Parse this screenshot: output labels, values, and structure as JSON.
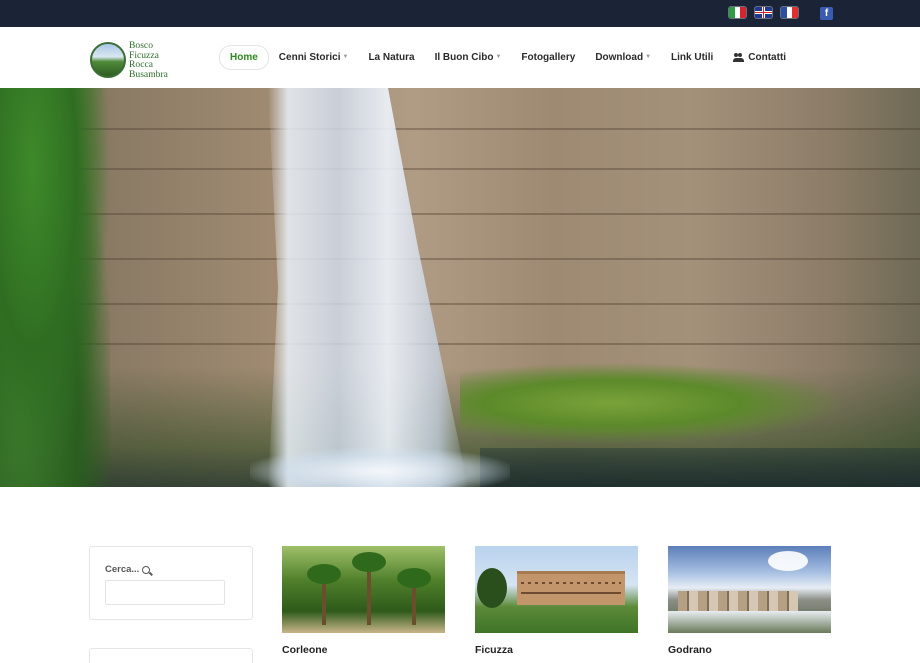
{
  "topbar": {
    "flags": [
      {
        "name": "italian-flag-icon",
        "colors": [
          "#2e9b46",
          "#ffffff",
          "#d4262e"
        ]
      },
      {
        "name": "uk-flag-icon",
        "colors": [
          "#1f3a8c",
          "#ffffff",
          "#d22222"
        ]
      },
      {
        "name": "french-flag-icon",
        "colors": [
          "#2a4ea1",
          "#ffffff",
          "#e0312f"
        ]
      }
    ],
    "facebook": "f",
    "background": "#1b2436"
  },
  "logo": {
    "lines": [
      "Bosco",
      "Ficuzza",
      "Rocca",
      "Busambra"
    ]
  },
  "nav": {
    "items": [
      {
        "label": "Home",
        "active": true,
        "dropdown": false
      },
      {
        "label": "Cenni Storici",
        "active": false,
        "dropdown": true
      },
      {
        "label": "La Natura",
        "active": false,
        "dropdown": false
      },
      {
        "label": "Il Buon Cibo",
        "active": false,
        "dropdown": true
      },
      {
        "label": "Fotogallery",
        "active": false,
        "dropdown": false
      },
      {
        "label": "Download",
        "active": false,
        "dropdown": true
      },
      {
        "label": "Link Utili",
        "active": false,
        "dropdown": false
      },
      {
        "label": "Contatti",
        "active": false,
        "dropdown": false,
        "icon": "users-icon"
      }
    ],
    "active_color": "#2c8a1f"
  },
  "sidebar": {
    "search_label": "Cerca...",
    "search_value": ""
  },
  "cards": [
    {
      "title": "Corleone"
    },
    {
      "title": "Ficuzza"
    },
    {
      "title": "Godrano"
    }
  ]
}
